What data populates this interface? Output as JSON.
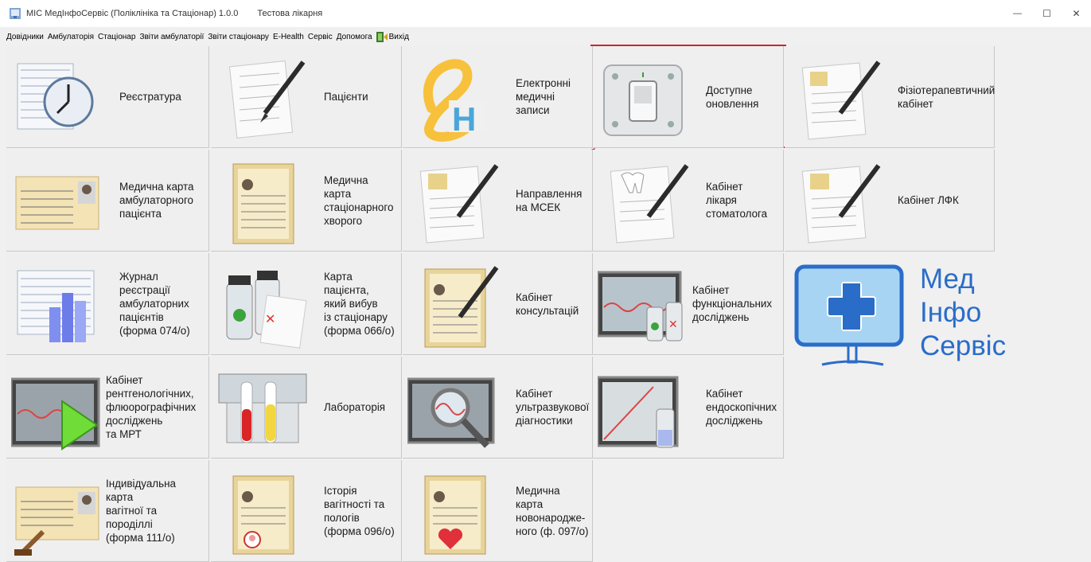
{
  "window": {
    "title": "МІС МедІнфоСервіс (Поліклініка та Стаціонар) 1.0.0",
    "subtitle": "Тестова лікарня",
    "minimize_glyph": "—",
    "maximize_glyph": "☐",
    "close_glyph": "✕"
  },
  "menu": {
    "items": [
      "Довідники",
      "Амбулаторія",
      "Стаціонар",
      "Звіти амбулаторії",
      "Звіти стаціонару",
      "E-Health",
      "Сервіс",
      "Допомога"
    ],
    "exit": "Вихід"
  },
  "tiles": [
    {
      "label": "Реєстратура",
      "icon": "registry-clock-icon"
    },
    {
      "label": "Пацієнти",
      "icon": "patients-form-pen-icon"
    },
    {
      "label": "Електронні\nмедичні\nзаписи",
      "icon": "ehealth-logo-icon"
    },
    {
      "label": "Доступне\nоновлення",
      "icon": "switch-update-icon"
    },
    {
      "label": "Фізіотерапевтичний\nкабінет",
      "icon": "physio-form-pen-icon"
    },
    {
      "label": "Медична карта\nамбулаторного\nпацієнта",
      "icon": "outpatient-card-icon"
    },
    {
      "label": "Медична карта\nстаціонарного\nхворого",
      "icon": "inpatient-folder-icon"
    },
    {
      "label": "Направлення\nна МСЕК",
      "icon": "msek-referral-icon"
    },
    {
      "label": "Кабінет\nлікаря\nстоматолога",
      "icon": "dentist-form-icon"
    },
    {
      "label": "Кабінет ЛФК",
      "icon": "lfk-form-icon"
    },
    {
      "label": "Журнал\nреєстрації\nамбулаторних\nпацієнтів\n(форма 074/о)",
      "icon": "journal-chart-icon"
    },
    {
      "label": "Карта пацієнта,\nякий вибув\nіз стаціонару\n(форма 066/о)",
      "icon": "discharge-bottles-icon"
    },
    {
      "label": "Кабінет\nконсультацій",
      "icon": "consultation-folder-icon"
    },
    {
      "label": "Кабінет\nфункціональних\nдосліджень",
      "icon": "functional-monitor-icon"
    },
    {
      "label": "Кабінет\nрентгенологічних,\nфлюорографічних\nдосліджень\nта МРТ",
      "icon": "xray-monitor-play-icon"
    },
    {
      "label": "Лабораторія",
      "icon": "lab-tubes-icon"
    },
    {
      "label": "Кабінет\nультразвукової\nдіагностики",
      "icon": "ultrasound-magnifier-icon"
    },
    {
      "label": "Кабінет\nендоскопічних\nдосліджень",
      "icon": "endoscopy-monitor-icon"
    },
    {
      "label": "Індивідуальна\nкарта\nвагітної та\nпороділлі\n(форма 111/о)",
      "icon": "pregnancy-card-stamp-icon"
    },
    {
      "label": "Історія\nвагітності та\nпологів\n(форма 096/о)",
      "icon": "pregnancy-history-icon"
    },
    {
      "label": "Медична\nкарта\nновонароджe-\nного (ф. 097/о)",
      "icon": "newborn-card-heart-icon"
    }
  ],
  "logo": {
    "text": "Мед\nІнфо\nСервіс",
    "color": "#2a6dc9",
    "icon": "monitor-cross-logo-icon"
  },
  "colors": {
    "highlight": "#c8282e",
    "indicator": "#ff1a1a",
    "background": "#f0f0f0"
  }
}
